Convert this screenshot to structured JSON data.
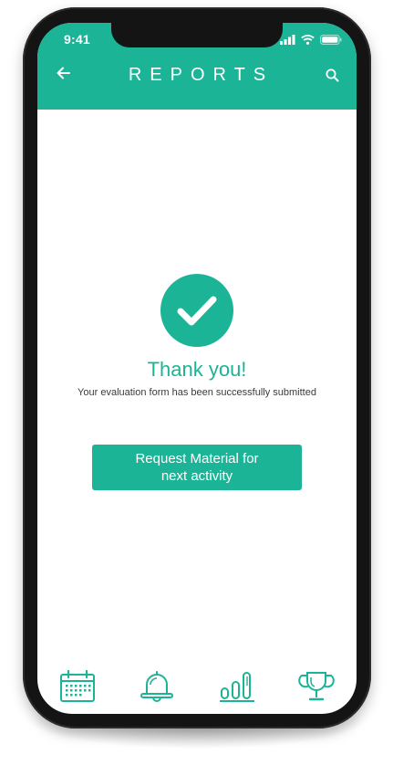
{
  "status_bar": {
    "time": "9:41"
  },
  "header": {
    "title": "REPORTS",
    "back_icon": "arrow-left-icon",
    "search_icon": "search-icon"
  },
  "confirmation": {
    "icon": "checkmark-icon",
    "title": "Thank you!",
    "message": "Your evaluation form has been successfully submitted"
  },
  "action": {
    "label": "Request Material for\nnext activity"
  },
  "tab_bar": {
    "items": [
      {
        "icon": "calendar-icon"
      },
      {
        "icon": "bell-icon"
      },
      {
        "icon": "bar-chart-icon"
      },
      {
        "icon": "trophy-icon"
      }
    ]
  },
  "colors": {
    "accent": "#1bb496",
    "text": "#3a3a3a",
    "device": "#141414"
  }
}
